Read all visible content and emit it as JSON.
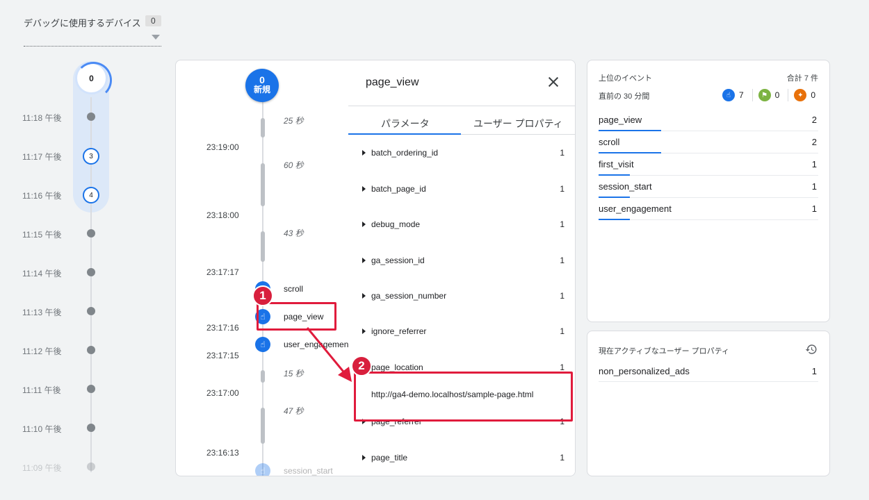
{
  "device": {
    "label": "デバッグに使用するデバイス",
    "count": "0"
  },
  "minutes": {
    "top_count": "0",
    "rows": [
      {
        "time": "11:18 午後",
        "count": ""
      },
      {
        "time": "11:17 午後",
        "count": "3"
      },
      {
        "time": "11:16 午後",
        "count": "4"
      },
      {
        "time": "11:15 午後",
        "count": ""
      },
      {
        "time": "11:14 午後",
        "count": ""
      },
      {
        "time": "11:13 午後",
        "count": ""
      },
      {
        "time": "11:12 午後",
        "count": ""
      },
      {
        "time": "11:11 午後",
        "count": ""
      },
      {
        "time": "11:10 午後",
        "count": ""
      },
      {
        "time": "11:09 午後",
        "count": ""
      }
    ]
  },
  "seconds": {
    "new_count": "0",
    "new_label": "新規",
    "gaps": [
      "25 秒",
      "60 秒",
      "43 秒",
      "15 秒",
      "47 秒"
    ],
    "times": [
      "23:19:00",
      "23:18:00",
      "23:17:17",
      "23:17:16",
      "23:17:15",
      "23:17:00",
      "23:16:13"
    ],
    "events": [
      "scroll",
      "page_view",
      "user_engagement",
      "session_start"
    ]
  },
  "params": {
    "title": "page_view",
    "tabs": [
      "パラメータ",
      "ユーザー プロパティ"
    ],
    "rows": [
      {
        "name": "batch_ordering_id",
        "value": "1"
      },
      {
        "name": "batch_page_id",
        "value": "1"
      },
      {
        "name": "debug_mode",
        "value": "1"
      },
      {
        "name": "ga_session_id",
        "value": "1"
      },
      {
        "name": "ga_session_number",
        "value": "1"
      },
      {
        "name": "ignore_referrer",
        "value": "1"
      },
      {
        "name": "page_location",
        "value": "1"
      },
      {
        "name": "page_referrer",
        "value": "1"
      },
      {
        "name": "page_title",
        "value": "1"
      }
    ],
    "expanded_value": "http://ga4-demo.localhost/sample-page.html"
  },
  "annotations": [
    "1",
    "2"
  ],
  "top_events": {
    "title": "上位のイベント",
    "total": "合計 7 件",
    "period": "直前の 30 分間",
    "counters": [
      {
        "icon": "touch-icon",
        "value": "7",
        "color": "#1a73e8"
      },
      {
        "icon": "flag-icon",
        "value": "0",
        "color": "#7cb342"
      },
      {
        "icon": "gift-icon",
        "value": "0",
        "color": "#e8710a"
      }
    ],
    "rows": [
      {
        "name": "page_view",
        "count": "2",
        "share": 0.286
      },
      {
        "name": "scroll",
        "count": "2",
        "share": 0.286
      },
      {
        "name": "first_visit",
        "count": "1",
        "share": 0.143
      },
      {
        "name": "session_start",
        "count": "1",
        "share": 0.143
      },
      {
        "name": "user_engagement",
        "count": "1",
        "share": 0.143
      }
    ]
  },
  "user_props": {
    "title": "現在アクティブなユーザー プロパティ",
    "rows": [
      {
        "name": "non_personalized_ads",
        "value": "1"
      }
    ]
  }
}
